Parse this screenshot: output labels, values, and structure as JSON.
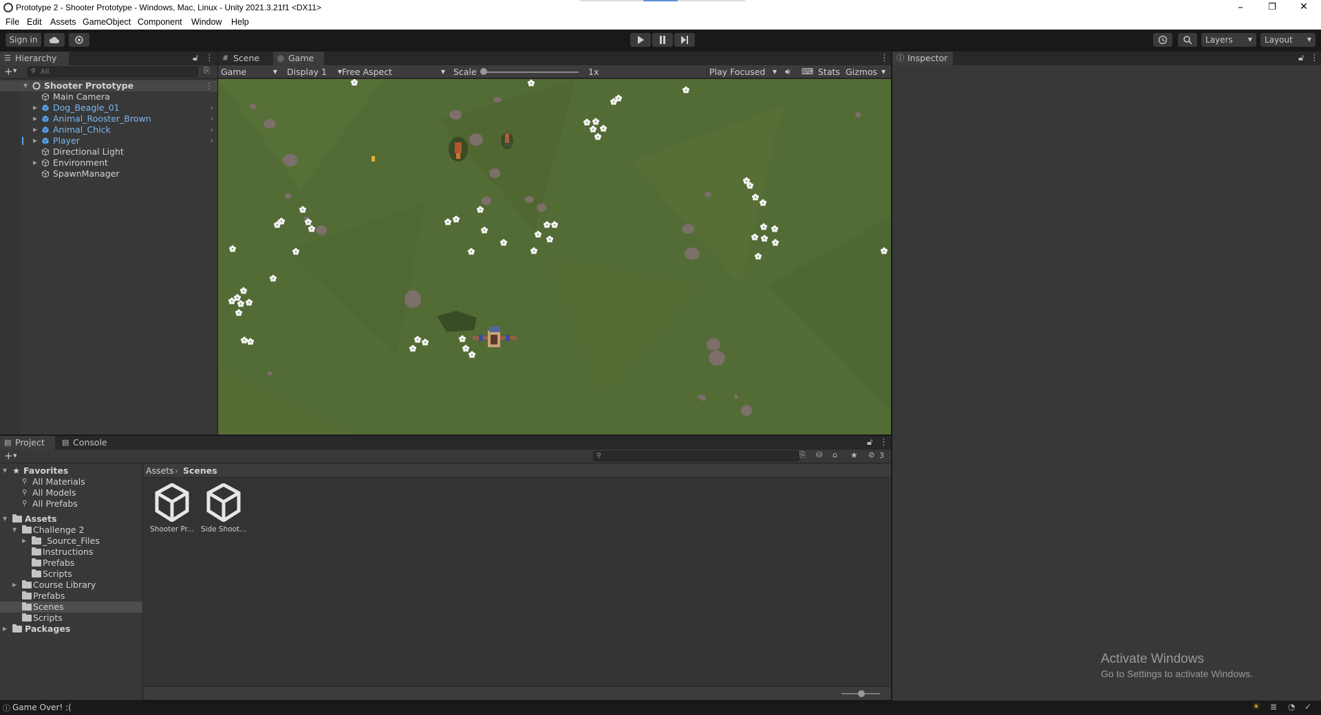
{
  "window": {
    "title": "Prototype 2 - Shooter Prototype - Windows, Mac, Linux - Unity 2021.3.21f1 <DX11>",
    "minimize": "–",
    "restore": "❐",
    "close": "✕"
  },
  "menu": [
    "File",
    "Edit",
    "Assets",
    "GameObject",
    "Component",
    "Window",
    "Help"
  ],
  "toolbar": {
    "sign_in": "Sign in",
    "layers": "Layers",
    "layout": "Layout"
  },
  "hierarchy": {
    "tab": "Hierarchy",
    "search_placeholder": "All",
    "scene": "Shooter Prototype",
    "items": [
      {
        "label": "Main Camera",
        "prefab": false
      },
      {
        "label": "Dog_Beagle_01",
        "prefab": true
      },
      {
        "label": "Animal_Rooster_Brown",
        "prefab": true
      },
      {
        "label": "Animal_Chick",
        "prefab": true
      },
      {
        "label": "Player",
        "prefab": true
      },
      {
        "label": "Directional Light",
        "prefab": false
      },
      {
        "label": "Environment",
        "prefab": false
      },
      {
        "label": "SpawnManager",
        "prefab": false
      }
    ]
  },
  "game_view": {
    "tabs": [
      "Scene",
      "Game"
    ],
    "active_tab": "Game",
    "mode": "Game",
    "display": "Display 1",
    "aspect": "Free Aspect",
    "scale_label": "Scale",
    "scale_value": "1x",
    "play_mode": "Play Focused",
    "stats": "Stats",
    "gizmos": "Gizmos",
    "grass_color": "#536b35"
  },
  "inspector": {
    "tab": "Inspector"
  },
  "watermark": {
    "line1": "Activate Windows",
    "line2": "Go to Settings to activate Windows."
  },
  "project": {
    "tabs": [
      "Project",
      "Console"
    ],
    "hidden_count": "3",
    "favorites": {
      "label": "Favorites",
      "items": [
        "All Materials",
        "All Models",
        "All Prefabs"
      ]
    },
    "assets_label": "Assets",
    "tree": {
      "challenge": "Challenge 2",
      "source_files": "_Source_Files",
      "instructions": "Instructions",
      "challenge_prefabs": "Prefabs",
      "challenge_scripts": "Scripts",
      "course_library": "Course Library",
      "prefabs": "Prefabs",
      "scenes": "Scenes",
      "scripts": "Scripts"
    },
    "packages_label": "Packages",
    "breadcrumb": [
      "Assets",
      "Scenes"
    ],
    "files": [
      "Shooter Pr...",
      "Side Shoot..."
    ]
  },
  "status": {
    "message": "Game Over! :("
  }
}
